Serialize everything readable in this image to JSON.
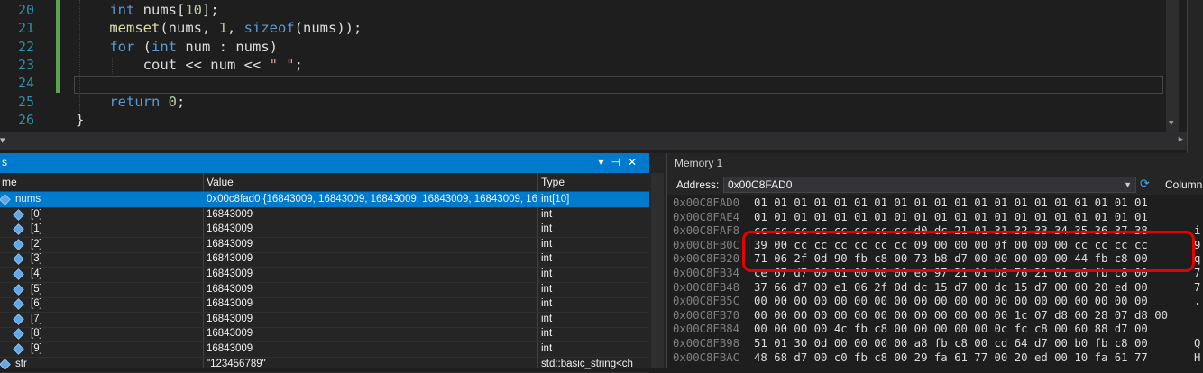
{
  "editor": {
    "lines": [
      {
        "num": "20",
        "tokens": [
          {
            "t": "    "
          },
          {
            "t": "int",
            "c": "kw"
          },
          {
            "t": " nums[",
            "c": "plain"
          },
          {
            "t": "10",
            "c": "num"
          },
          {
            "t": "];",
            "c": "plain"
          }
        ]
      },
      {
        "num": "21",
        "tokens": [
          {
            "t": "    "
          },
          {
            "t": "memset",
            "c": "fn"
          },
          {
            "t": "(nums, ",
            "c": "plain"
          },
          {
            "t": "1",
            "c": "num"
          },
          {
            "t": ", ",
            "c": "plain"
          },
          {
            "t": "sizeof",
            "c": "kw"
          },
          {
            "t": "(nums));",
            "c": "plain"
          }
        ]
      },
      {
        "num": "22",
        "tokens": [
          {
            "t": "    "
          },
          {
            "t": "for",
            "c": "kw"
          },
          {
            "t": " (",
            "c": "plain"
          },
          {
            "t": "int",
            "c": "kw"
          },
          {
            "t": " num : nums)",
            "c": "plain"
          }
        ]
      },
      {
        "num": "23",
        "tokens": [
          {
            "t": "        "
          },
          {
            "t": "cout << num << ",
            "c": "plain"
          },
          {
            "t": "\" \"",
            "c": "str"
          },
          {
            "t": ";",
            "c": "plain"
          }
        ]
      },
      {
        "num": "24",
        "tokens": []
      },
      {
        "num": "25",
        "tokens": [
          {
            "t": "    "
          },
          {
            "t": "return",
            "c": "kw"
          },
          {
            "t": " ",
            "c": "plain"
          },
          {
            "t": "0",
            "c": "num"
          },
          {
            "t": ";",
            "c": "plain"
          }
        ]
      },
      {
        "num": "26",
        "tokens": [
          {
            "t": "}",
            "c": "plain"
          }
        ]
      }
    ]
  },
  "watch": {
    "title": "s",
    "columns": {
      "name": "me",
      "value": "Value",
      "type": "Type"
    },
    "rows": [
      {
        "name": "nums",
        "value": "0x00c8fad0 {16843009, 16843009, 16843009, 16843009, 16843009, 168...",
        "type": "int[10]",
        "selected": true,
        "top": true
      },
      {
        "name": "[0]",
        "value": "16843009",
        "type": "int"
      },
      {
        "name": "[1]",
        "value": "16843009",
        "type": "int"
      },
      {
        "name": "[2]",
        "value": "16843009",
        "type": "int"
      },
      {
        "name": "[3]",
        "value": "16843009",
        "type": "int"
      },
      {
        "name": "[4]",
        "value": "16843009",
        "type": "int"
      },
      {
        "name": "[5]",
        "value": "16843009",
        "type": "int"
      },
      {
        "name": "[6]",
        "value": "16843009",
        "type": "int"
      },
      {
        "name": "[7]",
        "value": "16843009",
        "type": "int"
      },
      {
        "name": "[8]",
        "value": "16843009",
        "type": "int"
      },
      {
        "name": "[9]",
        "value": "16843009",
        "type": "int"
      },
      {
        "name": "str",
        "value": "\"123456789\"",
        "type": "std::basic_string<ch",
        "top": true
      }
    ]
  },
  "memory": {
    "title": "Memory 1",
    "address_label": "Address:",
    "address_value": "0x00C8FAD0",
    "columns_label": "Column",
    "rows": [
      {
        "addr": "0x00C8FAD0",
        "bytes": "01 01 01 01 01 01 01 01 01 01 01 01 01 01 01 01 01 01 01 01",
        "ascii": ""
      },
      {
        "addr": "0x00C8FAE4",
        "bytes": "01 01 01 01 01 01 01 01 01 01 01 01 01 01 01 01 01 01 01 01",
        "ascii": ""
      },
      {
        "addr": "0x00C8FAF8",
        "bytes": "cc cc cc cc cc cc cc cc d0 dc 21 01 31 32 33 34 35 36 37 38",
        "ascii": "i"
      },
      {
        "addr": "0x00C8FB0C",
        "bytes": "39 00 cc cc cc cc cc cc 09 00 00 00 0f 00 00 00 cc cc cc cc",
        "ascii": "9"
      },
      {
        "addr": "0x00C8FB20",
        "bytes": "71 06 2f 0d 90 fb c8 00 73 b8 d7 00 00 00 00 00 44 fb c8 00",
        "ascii": "q"
      },
      {
        "addr": "0x00C8FB34",
        "bytes": "ce 67 d7 00 01 00 00 00 e8 97 21 01 b8 76 21 01 a0 fb c8 00",
        "ascii": "7"
      },
      {
        "addr": "0x00C8FB48",
        "bytes": "37 66 d7 00 e1 06 2f 0d dc 15 d7 00 dc 15 d7 00 00 20 ed 00",
        "ascii": "7"
      },
      {
        "addr": "0x00C8FB5C",
        "bytes": "00 00 00 00 00 00 00 00 00 00 00 00 00 00 00 00 00 00 00 00",
        "ascii": "."
      },
      {
        "addr": "0x00C8FB70",
        "bytes": "00 00 00 00 00 00 00 00 00 00 00 00 00 1c 07 d8 00 28 07 d8 00",
        "ascii": ""
      },
      {
        "addr": "0x00C8FB84",
        "bytes": "00 00 00 00 4c fb c8 00 00 00 00 00 0c fc c8 00 60 88 d7 00",
        "ascii": ""
      },
      {
        "addr": "0x00C8FB98",
        "bytes": "51 01 30 0d 00 00 00 00 a8 fb c8 00 cd 64 d7 00 b0 fb c8 00",
        "ascii": "Q"
      },
      {
        "addr": "0x00C8FBAC",
        "bytes": "48 68 d7 00 c0 fb c8 00 29 fa 61 77 00 20 ed 00 10 fa 61 77",
        "ascii": "H"
      }
    ]
  },
  "colors": {
    "accent": "#007acc",
    "highlight": "#e60000"
  }
}
